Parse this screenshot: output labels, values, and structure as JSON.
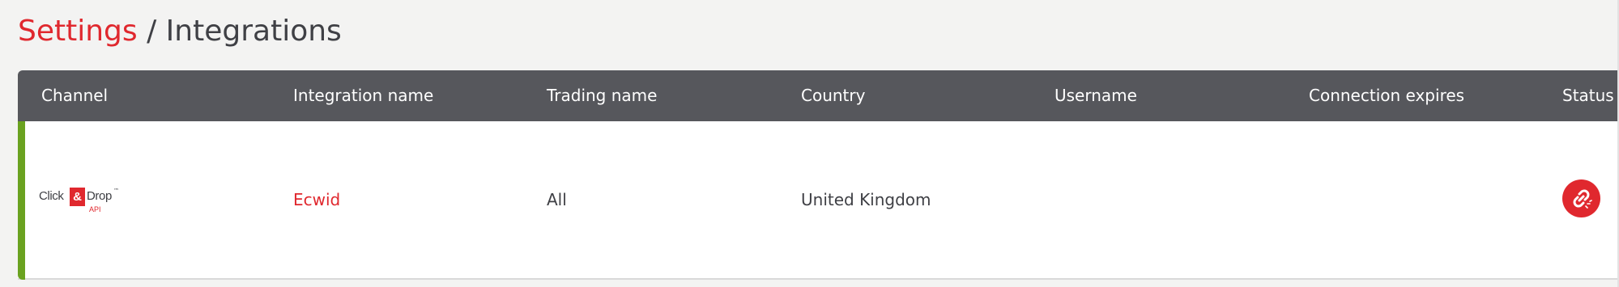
{
  "breadcrumb": {
    "parent": "Settings",
    "separator": " / ",
    "current": "Integrations"
  },
  "table": {
    "columns": [
      "Channel",
      "Integration name",
      "Trading name",
      "Country",
      "Username",
      "Connection expires",
      "Status"
    ],
    "rows": [
      {
        "channel": {
          "logo_text_left": "Click",
          "logo_text_amp": "&",
          "logo_text_right": "Drop",
          "logo_text_tm": "™",
          "logo_text_sub": "API"
        },
        "integration_name": "Ecwid",
        "trading_name": "All",
        "country": "United Kingdom",
        "username": "",
        "connection_expires": "",
        "status_icon": "broken-link-icon",
        "accent_color": "#6aa220"
      }
    ]
  },
  "colors": {
    "brand_red": "#e0282e",
    "header_bg": "#56575c",
    "page_bg": "#f3f3f2",
    "row_accent_green": "#6aa220"
  }
}
